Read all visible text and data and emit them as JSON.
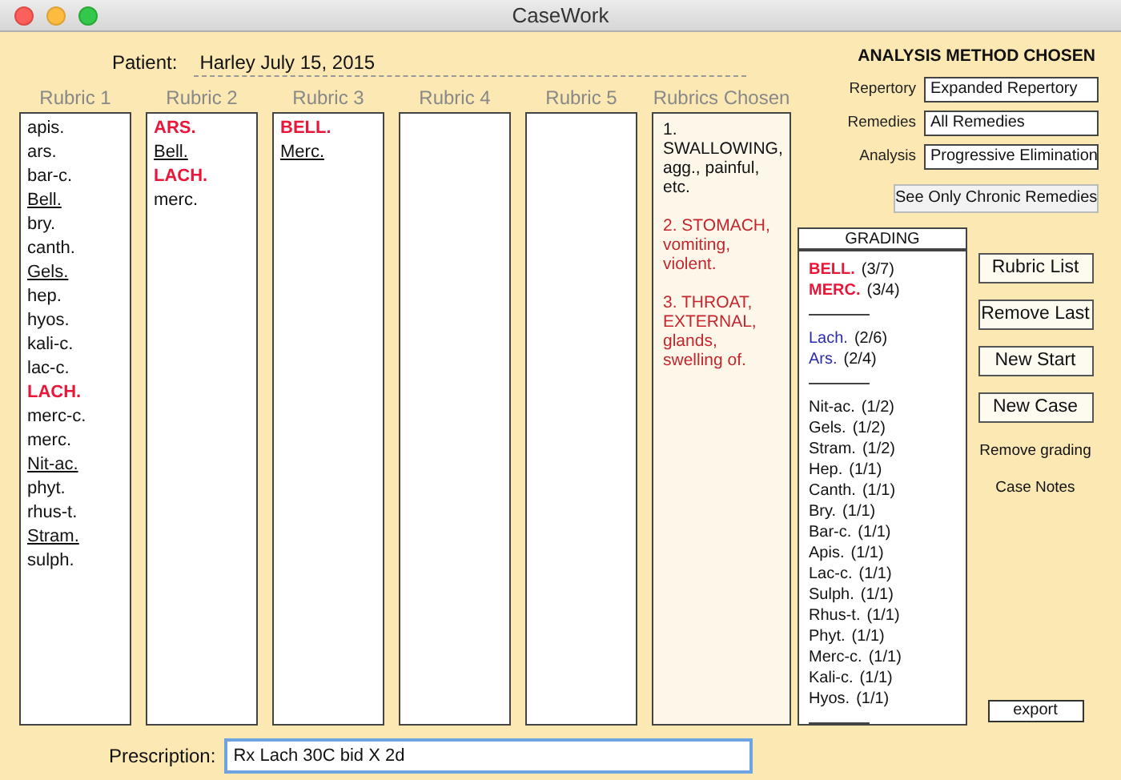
{
  "window": {
    "title": "CaseWork"
  },
  "patient": {
    "label": "Patient:",
    "value": "Harley July 15, 2015"
  },
  "rubrics": [
    {
      "title": "Rubric 1",
      "remedies": [
        {
          "text": "apis.",
          "kind": "plain"
        },
        {
          "text": "ars.",
          "kind": "plain"
        },
        {
          "text": "bar-c.",
          "kind": "plain"
        },
        {
          "text": "Bell.",
          "kind": "underline"
        },
        {
          "text": "bry.",
          "kind": "plain"
        },
        {
          "text": "canth.",
          "kind": "plain"
        },
        {
          "text": "Gels.",
          "kind": "underline"
        },
        {
          "text": "hep.",
          "kind": "plain"
        },
        {
          "text": "hyos.",
          "kind": "plain"
        },
        {
          "text": "kali-c.",
          "kind": "plain"
        },
        {
          "text": "lac-c.",
          "kind": "plain"
        },
        {
          "text": "LACH.",
          "kind": "bold"
        },
        {
          "text": "merc-c.",
          "kind": "plain"
        },
        {
          "text": "merc.",
          "kind": "plain"
        },
        {
          "text": "Nit-ac.",
          "kind": "underline"
        },
        {
          "text": "phyt.",
          "kind": "plain"
        },
        {
          "text": "rhus-t.",
          "kind": "plain"
        },
        {
          "text": "Stram.",
          "kind": "underline"
        },
        {
          "text": "sulph.",
          "kind": "plain"
        }
      ]
    },
    {
      "title": "Rubric 2",
      "remedies": [
        {
          "text": "ARS.",
          "kind": "bold"
        },
        {
          "text": "Bell.",
          "kind": "underline"
        },
        {
          "text": "LACH.",
          "kind": "bold"
        },
        {
          "text": "merc.",
          "kind": "plain"
        }
      ]
    },
    {
      "title": "Rubric 3",
      "remedies": [
        {
          "text": "BELL.",
          "kind": "bold"
        },
        {
          "text": "Merc.",
          "kind": "underline"
        }
      ]
    },
    {
      "title": "Rubric 4"
    },
    {
      "title": "Rubric 5"
    }
  ],
  "rubrics_chosen": {
    "title": "Rubrics Chosen",
    "items": [
      {
        "text": "1. SWALLOWING, agg., painful, etc.",
        "color": "#111111"
      },
      {
        "text": "2. STOMACH, vomiting, violent.",
        "color": "#c4262e"
      },
      {
        "text": "3. THROAT, EXTERNAL, glands, swelling of.",
        "color": "#c4262e"
      }
    ]
  },
  "analysis": {
    "title": "ANALYSIS METHOD CHOSEN",
    "fields": [
      {
        "label": "Repertory",
        "value": "Expanded Repertory"
      },
      {
        "label": "Remedies",
        "value": "All Remedies"
      },
      {
        "label": "Analysis",
        "value": "Progressive Elimination"
      }
    ],
    "button": "See Only Chronic Remedies"
  },
  "grading": {
    "title": "GRADING",
    "entries": [
      {
        "kind": "top",
        "name": "BELL.",
        "score": "(3/7)"
      },
      {
        "kind": "top",
        "name": "MERC.",
        "score": "(3/4)"
      },
      {
        "kind": "separator"
      },
      {
        "kind": "mid",
        "name": "Lach.",
        "score": "(2/6)"
      },
      {
        "kind": "mid",
        "name": "Ars.",
        "score": "(2/4)"
      },
      {
        "kind": "separator"
      },
      {
        "kind": "low",
        "name": "Nit-ac.",
        "score": "(1/2)"
      },
      {
        "kind": "low",
        "name": "Gels.",
        "score": "(1/2)"
      },
      {
        "kind": "low",
        "name": "Stram.",
        "score": "(1/2)"
      },
      {
        "kind": "low",
        "name": "Hep.",
        "score": "(1/1)"
      },
      {
        "kind": "low",
        "name": "Canth.",
        "score": "(1/1)"
      },
      {
        "kind": "low",
        "name": "Bry.",
        "score": "(1/1)"
      },
      {
        "kind": "low",
        "name": "Bar-c.",
        "score": "(1/1)"
      },
      {
        "kind": "low",
        "name": "Apis.",
        "score": "(1/1)"
      },
      {
        "kind": "low",
        "name": "Lac-c.",
        "score": "(1/1)"
      },
      {
        "kind": "low",
        "name": "Sulph.",
        "score": "(1/1)"
      },
      {
        "kind": "low",
        "name": "Rhus-t.",
        "score": "(1/1)"
      },
      {
        "kind": "low",
        "name": "Phyt.",
        "score": "(1/1)"
      },
      {
        "kind": "low",
        "name": "Merc-c.",
        "score": "(1/1)"
      },
      {
        "kind": "low",
        "name": "Kali-c.",
        "score": "(1/1)"
      },
      {
        "kind": "low",
        "name": "Hyos.",
        "score": "(1/1)"
      },
      {
        "kind": "separator"
      }
    ]
  },
  "buttons": [
    "Rubric List",
    "Remove Last",
    "New Start",
    "New Case"
  ],
  "links": [
    "Remove grading",
    "Case Notes"
  ],
  "export": "export",
  "prescription": {
    "label": "Prescription:",
    "value": "Rx Lach 30C bid X 2d"
  }
}
